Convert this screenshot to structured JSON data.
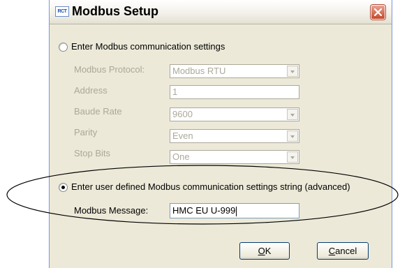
{
  "window": {
    "title": "Modbus Setup",
    "icon_text": "RCT",
    "icons": {
      "app": "rct-app-icon",
      "close": "close-icon"
    }
  },
  "option_standard": {
    "label": "Enter Modbus communication settings",
    "selected": false
  },
  "fields": [
    {
      "label": "Modbus Protocol:",
      "value": "Modbus RTU",
      "type": "dropdown"
    },
    {
      "label": "Address",
      "value": "1",
      "type": "text"
    },
    {
      "label": "Baude Rate",
      "value": "9600",
      "type": "dropdown"
    },
    {
      "label": "Parity",
      "value": "Even",
      "type": "dropdown"
    },
    {
      "label": "Stop Bits",
      "value": "One",
      "type": "dropdown"
    }
  ],
  "option_advanced": {
    "label": "Enter user defined Modbus communication settings string (advanced)",
    "selected": true
  },
  "message": {
    "label": "Modbus Message:",
    "value": "HMC EU U-999"
  },
  "buttons": {
    "ok_mnemonic": "O",
    "ok_rest": "K",
    "cancel_mnemonic": "C",
    "cancel_rest": "ancel"
  },
  "annotation": {
    "color": "#000000"
  }
}
